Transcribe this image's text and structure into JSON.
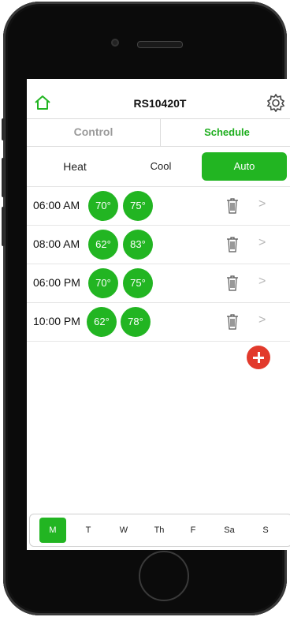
{
  "header": {
    "title": "RS10420T",
    "home_icon": "home-icon",
    "settings_icon": "gear-icon"
  },
  "tabs": [
    {
      "label": "Control",
      "active": false
    },
    {
      "label": "Schedule",
      "active": true
    }
  ],
  "modes": [
    {
      "label": "Heat",
      "active": false
    },
    {
      "label": "Cool",
      "active": false
    },
    {
      "label": "Auto",
      "active": true
    }
  ],
  "schedule": [
    {
      "time": "06:00 AM",
      "low": "70°",
      "high": "75°"
    },
    {
      "time": "08:00 AM",
      "low": "62°",
      "high": "83°"
    },
    {
      "time": "06:00 PM",
      "low": "70°",
      "high": "75°"
    },
    {
      "time": "10:00 PM",
      "low": "62°",
      "high": "78°"
    }
  ],
  "row_chevron": ">",
  "days": [
    "M",
    "T",
    "W",
    "Th",
    "F",
    "Sa",
    "S"
  ],
  "selected_day": "M",
  "colors": {
    "accent": "#22b522",
    "add": "#e23a2c",
    "inactive_tab": "#9a9a9a"
  }
}
